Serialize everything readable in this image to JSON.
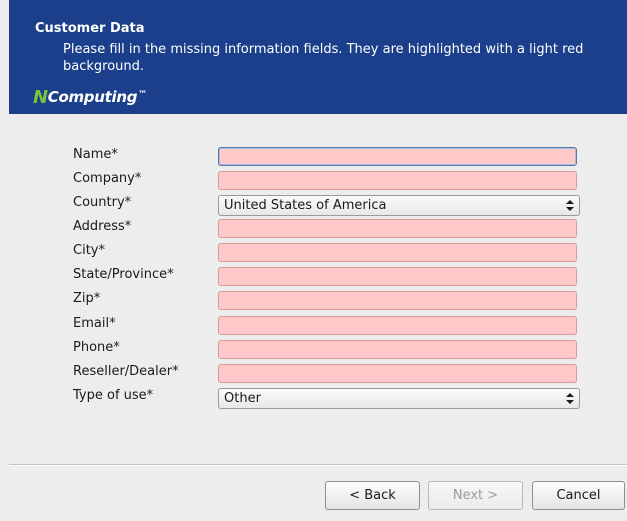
{
  "header": {
    "title": "Customer Data",
    "description": "Please fill in the missing information fields. They are highlighted with a light red background.",
    "logo": {
      "mark": "N",
      "text": "Computing",
      "tm": "™"
    }
  },
  "form": {
    "fields": [
      {
        "label": "Name*",
        "type": "text",
        "value": ""
      },
      {
        "label": "Company*",
        "type": "text",
        "value": ""
      },
      {
        "label": "Country*",
        "type": "select",
        "value": "United States of America"
      },
      {
        "label": "Address*",
        "type": "text",
        "value": ""
      },
      {
        "label": "City*",
        "type": "text",
        "value": ""
      },
      {
        "label": "State/Province*",
        "type": "text",
        "value": ""
      },
      {
        "label": "Zip*",
        "type": "text",
        "value": ""
      },
      {
        "label": "Email*",
        "type": "text",
        "value": ""
      },
      {
        "label": "Phone*",
        "type": "text",
        "value": ""
      },
      {
        "label": "Reseller/Dealer*",
        "type": "text",
        "value": ""
      },
      {
        "label": "Type of use*",
        "type": "select",
        "value": "Other"
      }
    ]
  },
  "buttons": {
    "back": "< Back",
    "next": "Next >",
    "cancel": "Cancel"
  },
  "colors": {
    "header_bg": "#1b3f8b",
    "missing_field_bg": "#ffc9c9",
    "logo_accent": "#7ec242"
  }
}
